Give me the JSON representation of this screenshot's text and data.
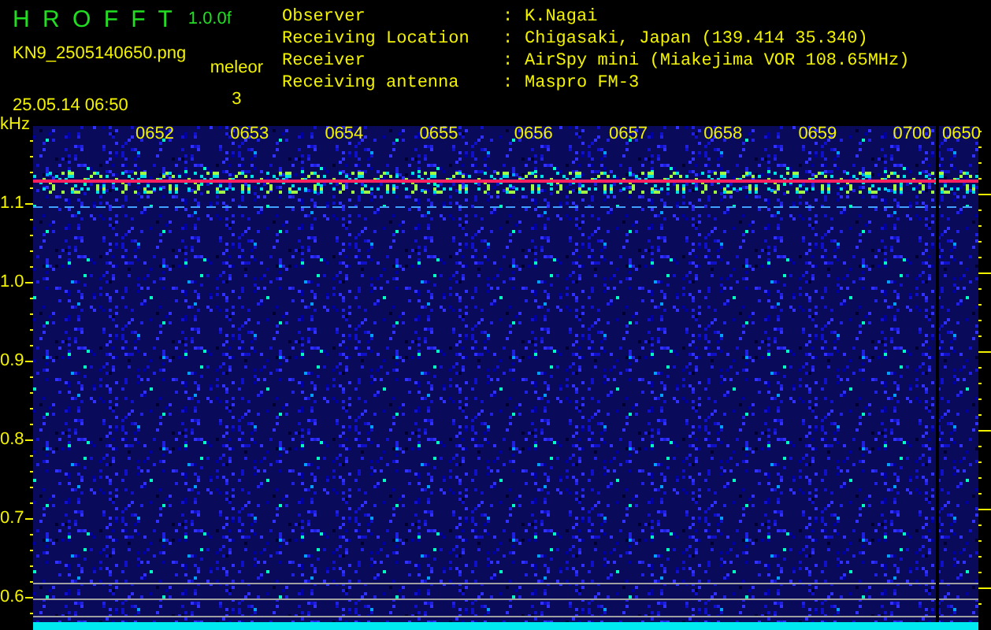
{
  "app": {
    "title": "H R O F F T",
    "version": "1.0.0f",
    "filename": "KN9_2505140650.png",
    "timestamp": "25.05.14 06:50",
    "count_label": "meleor",
    "count": "3"
  },
  "info": [
    {
      "label": "Observer",
      "separator": ":",
      "value": "K.Nagai"
    },
    {
      "label": "Receiving Location",
      "separator": ":",
      "value": "Chigasaki, Japan (139.414 35.340)"
    },
    {
      "label": "Receiver",
      "separator": ":",
      "value": "AirSpy mini (Miakejima VOR 108.65MHz)"
    },
    {
      "label": "Receiving antenna",
      "separator": ":",
      "value": "Maspro FM-3"
    }
  ],
  "plot": {
    "unit": "kHz",
    "y_labels": [
      "1.1",
      "1.0",
      "0.9",
      "0.8",
      "0.7",
      "0.6"
    ],
    "time_labels": [
      "0652",
      "0653",
      "0654",
      "0655",
      "0656",
      "0657",
      "0658",
      "0659",
      "0700",
      "0650"
    ]
  }
}
